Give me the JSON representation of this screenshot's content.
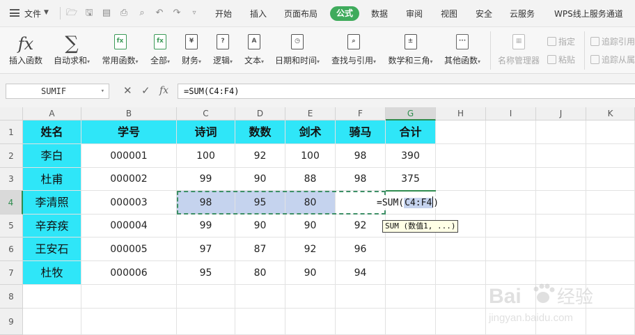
{
  "menubar": {
    "file_label": "文件",
    "tabs": [
      {
        "label": "开始"
      },
      {
        "label": "插入"
      },
      {
        "label": "页面布局"
      },
      {
        "label": "公式",
        "active": true
      },
      {
        "label": "数据"
      },
      {
        "label": "审阅"
      },
      {
        "label": "视图"
      },
      {
        "label": "安全"
      },
      {
        "label": "云服务"
      },
      {
        "label": "WPS线上服务通道"
      }
    ],
    "accent_color": "#3fab5c"
  },
  "ribbon": {
    "buttons": [
      {
        "label": "插入函数",
        "icon": "fx-icon"
      },
      {
        "label": "自动求和",
        "icon": "sigma-icon"
      },
      {
        "label": "常用函数",
        "icon": "star-function-icon"
      },
      {
        "label": "全部",
        "icon": "function-book-icon"
      },
      {
        "label": "财务",
        "icon": "yen-book-icon"
      },
      {
        "label": "逻辑",
        "icon": "question-book-icon"
      },
      {
        "label": "文本",
        "icon": "text-book-icon"
      },
      {
        "label": "日期和时间",
        "icon": "clock-book-icon"
      },
      {
        "label": "查找与引用",
        "icon": "search-book-icon"
      },
      {
        "label": "数学和三角",
        "icon": "math-book-icon"
      },
      {
        "label": "其他函数",
        "icon": "dots-book-icon"
      }
    ],
    "name_manager": "名称管理器",
    "define": "指定",
    "paste": "粘贴",
    "trace_precedents": "追踪引用",
    "trace_dependents": "追踪从属"
  },
  "formula_bar": {
    "name_box": "SUMIF",
    "formula": "=SUM(C4:F4)"
  },
  "sheet": {
    "columns": [
      "A",
      "B",
      "C",
      "D",
      "E",
      "F",
      "G",
      "H",
      "I",
      "J",
      "K"
    ],
    "rows": [
      "1",
      "2",
      "3",
      "4",
      "5",
      "6",
      "7",
      "8",
      "9"
    ],
    "header": [
      "姓名",
      "学号",
      "诗词",
      "数数",
      "剑术",
      "骑马",
      "合计"
    ],
    "data": [
      [
        "李白",
        "000001",
        "100",
        "92",
        "100",
        "98",
        "390"
      ],
      [
        "杜甫",
        "000002",
        "99",
        "90",
        "88",
        "98",
        "375"
      ],
      [
        "李清照",
        "000003",
        "98",
        "95",
        "80",
        "",
        ""
      ],
      [
        "辛弃疾",
        "000004",
        "99",
        "90",
        "90",
        "92",
        ""
      ],
      [
        "王安石",
        "000005",
        "97",
        "87",
        "92",
        "96",
        ""
      ],
      [
        "杜牧",
        "000006",
        "95",
        "80",
        "90",
        "94",
        ""
      ]
    ],
    "edit_prefix": "=SUM(",
    "edit_ref": "C4:F4",
    "edit_suffix": ")",
    "tooltip": "SUM (数值1, ...)",
    "header_fill": "#2fe6f8",
    "ref_fill": "#c5d3ee"
  },
  "watermark": {
    "brand": "Bai",
    "brand2": "经验",
    "url": "jingyan.baidu.com"
  }
}
